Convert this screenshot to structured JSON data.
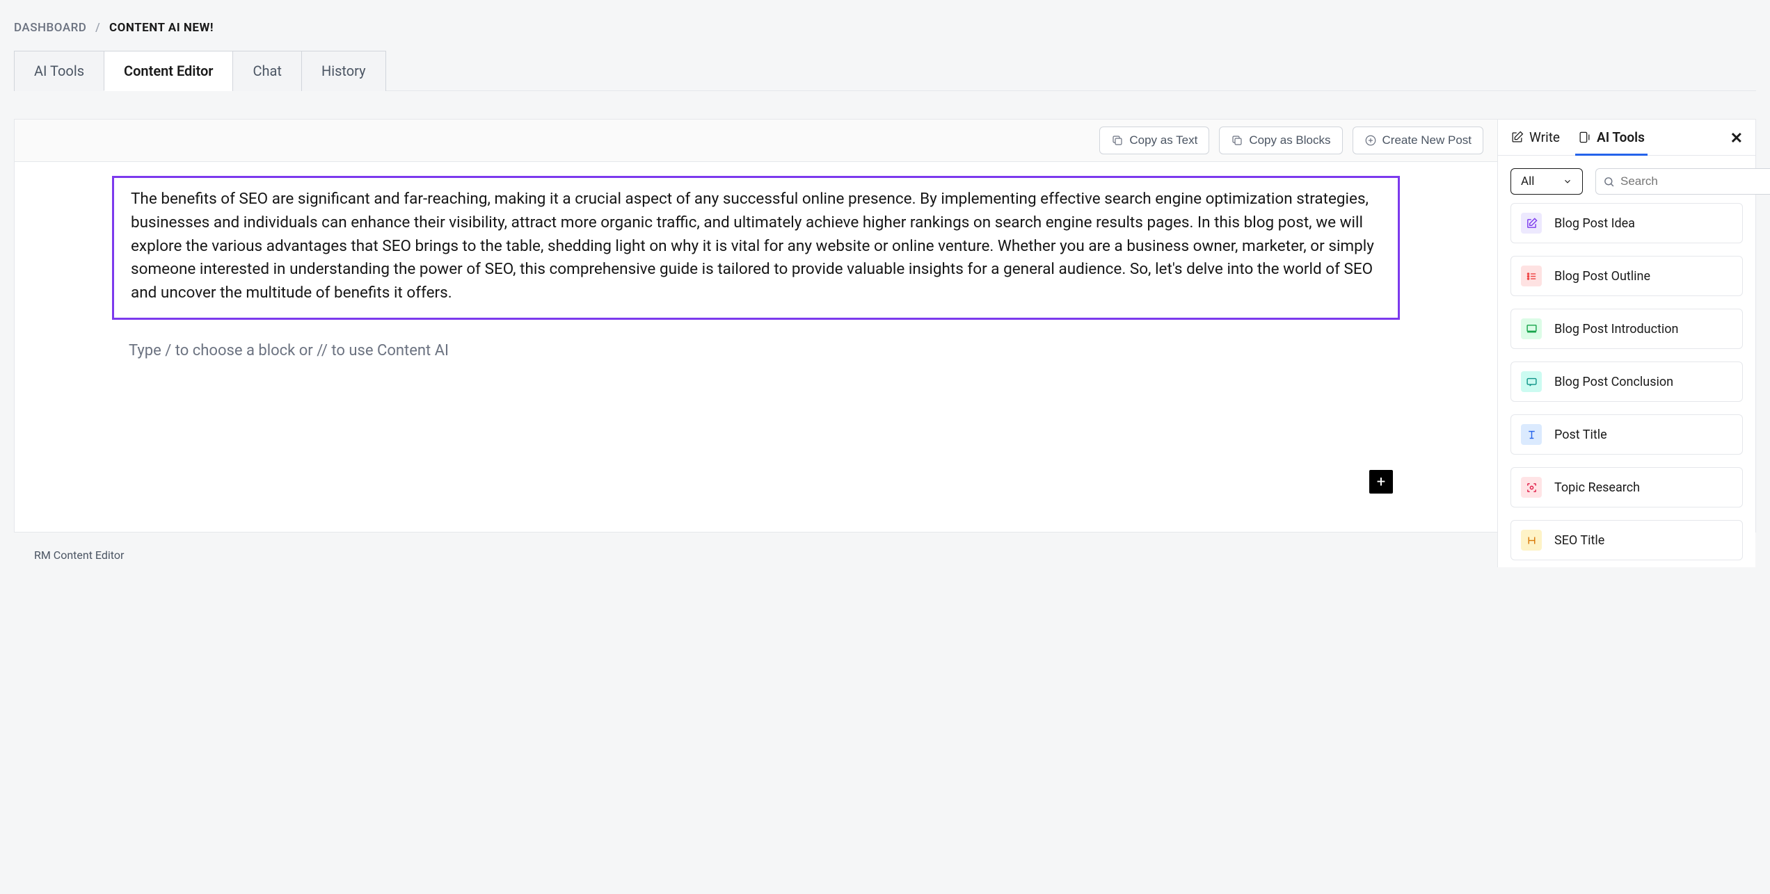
{
  "breadcrumbs": {
    "root": "DASHBOARD",
    "current": "CONTENT AI NEW!"
  },
  "tabs": {
    "items": [
      "AI Tools",
      "Content Editor",
      "Chat",
      "History"
    ],
    "active_index": 1
  },
  "toolbar": {
    "copy_text": "Copy as Text",
    "copy_blocks": "Copy as Blocks",
    "new_post": "Create New Post"
  },
  "editor": {
    "content": "The benefits of SEO are significant and far-reaching, making it a crucial aspect of any successful online presence. By implementing effective search engine optimization strategies, businesses and individuals can enhance their visibility, attract more organic traffic, and ultimately achieve higher rankings on search engine results pages. In this blog post, we will explore the various advantages that SEO brings to the table, shedding light on why it is vital for any website or online venture. Whether you are a business owner, marketer, or simply someone interested in understanding the power of SEO, this comprehensive guide is tailored to provide valuable insights for a general audience. So, let's delve into the world of SEO and uncover the multitude of benefits it offers.",
    "placeholder": "Type / to choose a block or // to use Content AI",
    "footer": "RM Content Editor"
  },
  "sidebar": {
    "tabs": {
      "write": "Write",
      "ai_tools": "AI Tools"
    },
    "filter": {
      "selected": "All"
    },
    "search": {
      "placeholder": "Search",
      "shortcut": "/"
    },
    "tools": [
      {
        "label": "Blog Post Idea",
        "icon": "edit",
        "color": "purple"
      },
      {
        "label": "Blog Post Outline",
        "icon": "list",
        "color": "red"
      },
      {
        "label": "Blog Post Introduction",
        "icon": "monitor",
        "color": "green"
      },
      {
        "label": "Blog Post Conclusion",
        "icon": "chat",
        "color": "teal"
      },
      {
        "label": "Post Title",
        "icon": "text",
        "color": "blue"
      },
      {
        "label": "Topic Research",
        "icon": "scan",
        "color": "rose"
      },
      {
        "label": "SEO Title",
        "icon": "heading",
        "color": "amber"
      }
    ]
  }
}
